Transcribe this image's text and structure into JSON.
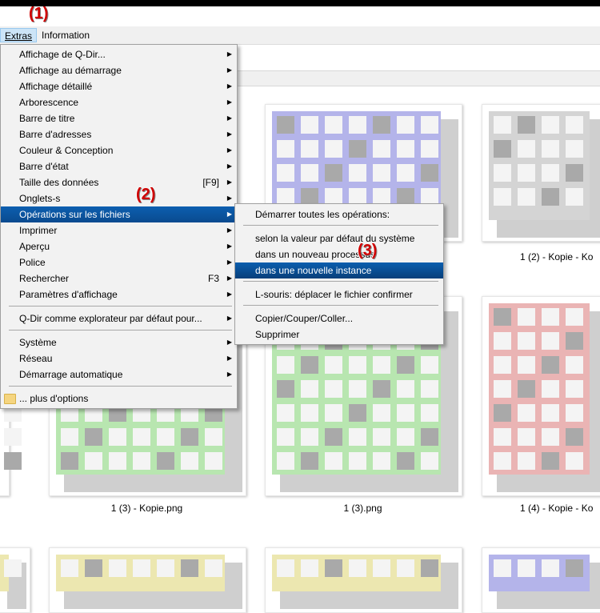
{
  "menubar": {
    "extras": "Extras",
    "information": "Information"
  },
  "annotations": {
    "a1": "(1)",
    "a2": "(2)",
    "a3": "(3)"
  },
  "extras_menu": [
    {
      "label": "Affichage de Q-Dir...",
      "shortcut": "",
      "arrow": true
    },
    {
      "label": "Affichage au démarrage",
      "shortcut": "",
      "arrow": true
    },
    {
      "label": "Affichage détaillé",
      "shortcut": "",
      "arrow": true
    },
    {
      "label": "Arborescence",
      "shortcut": "",
      "arrow": true
    },
    {
      "label": "Barre de titre",
      "shortcut": "",
      "arrow": true
    },
    {
      "label": "Barre d'adresses",
      "shortcut": "",
      "arrow": true
    },
    {
      "label": "Couleur & Conception",
      "shortcut": "",
      "arrow": true
    },
    {
      "label": "Barre d'état",
      "shortcut": "",
      "arrow": true
    },
    {
      "label": "Taille des données",
      "shortcut": "[F9]",
      "arrow": true
    },
    {
      "label": "Onglets-s",
      "shortcut": "",
      "arrow": true
    },
    {
      "label": "Opérations sur les fichiers",
      "shortcut": "",
      "arrow": true,
      "highlighted": true
    },
    {
      "label": "Imprimer",
      "shortcut": "",
      "arrow": true
    },
    {
      "label": "Aperçu",
      "shortcut": "",
      "arrow": true
    },
    {
      "label": "Police",
      "shortcut": "",
      "arrow": true
    },
    {
      "label": "Rechercher",
      "shortcut": "F3",
      "arrow": true
    },
    {
      "label": "Paramètres d'affichage",
      "shortcut": "",
      "arrow": true
    },
    {
      "label": "Q-Dir comme explorateur par défaut pour...",
      "shortcut": "",
      "arrow": true
    },
    {
      "label": "Système",
      "shortcut": "",
      "arrow": true
    },
    {
      "label": "Réseau",
      "shortcut": "",
      "arrow": true
    },
    {
      "label": "Démarrage automatique",
      "shortcut": "",
      "arrow": true
    },
    {
      "label": "... plus d'options",
      "shortcut": "",
      "arrow": false,
      "icon": "folder-icon"
    }
  ],
  "file_ops_menu": [
    {
      "label": "Démarrer toutes les opérations:"
    },
    {
      "label": "selon la valeur par défaut du système"
    },
    {
      "label": "dans un nouveau processus"
    },
    {
      "label": "dans une nouvelle instance",
      "highlighted": true
    },
    {
      "label": "L-souris: déplacer le fichier confirmer"
    },
    {
      "label": "Copier/Couper/Coller..."
    },
    {
      "label": "Supprimer"
    }
  ],
  "files": [
    {
      "caption": "",
      "color": "#b4b4ea"
    },
    {
      "caption": "1 (2) - Kopie - Ko",
      "color": "#d4d4d4"
    },
    {
      "caption": "1 (3) - Kopie.png",
      "color": "#b8e6b0"
    },
    {
      "caption": "1 (3).png",
      "color": "#b8e6b0"
    },
    {
      "caption": "1 (4) - Kopie - Ko",
      "color": "#eab4b4"
    },
    {
      "caption": "",
      "color": "#ece7b0"
    },
    {
      "caption": "",
      "color": "#ece7b0"
    },
    {
      "caption": "",
      "color": "#b4b4ea"
    }
  ],
  "colors": {
    "menu_highlight": "#0a4a8f",
    "annotation": "#d00000"
  }
}
